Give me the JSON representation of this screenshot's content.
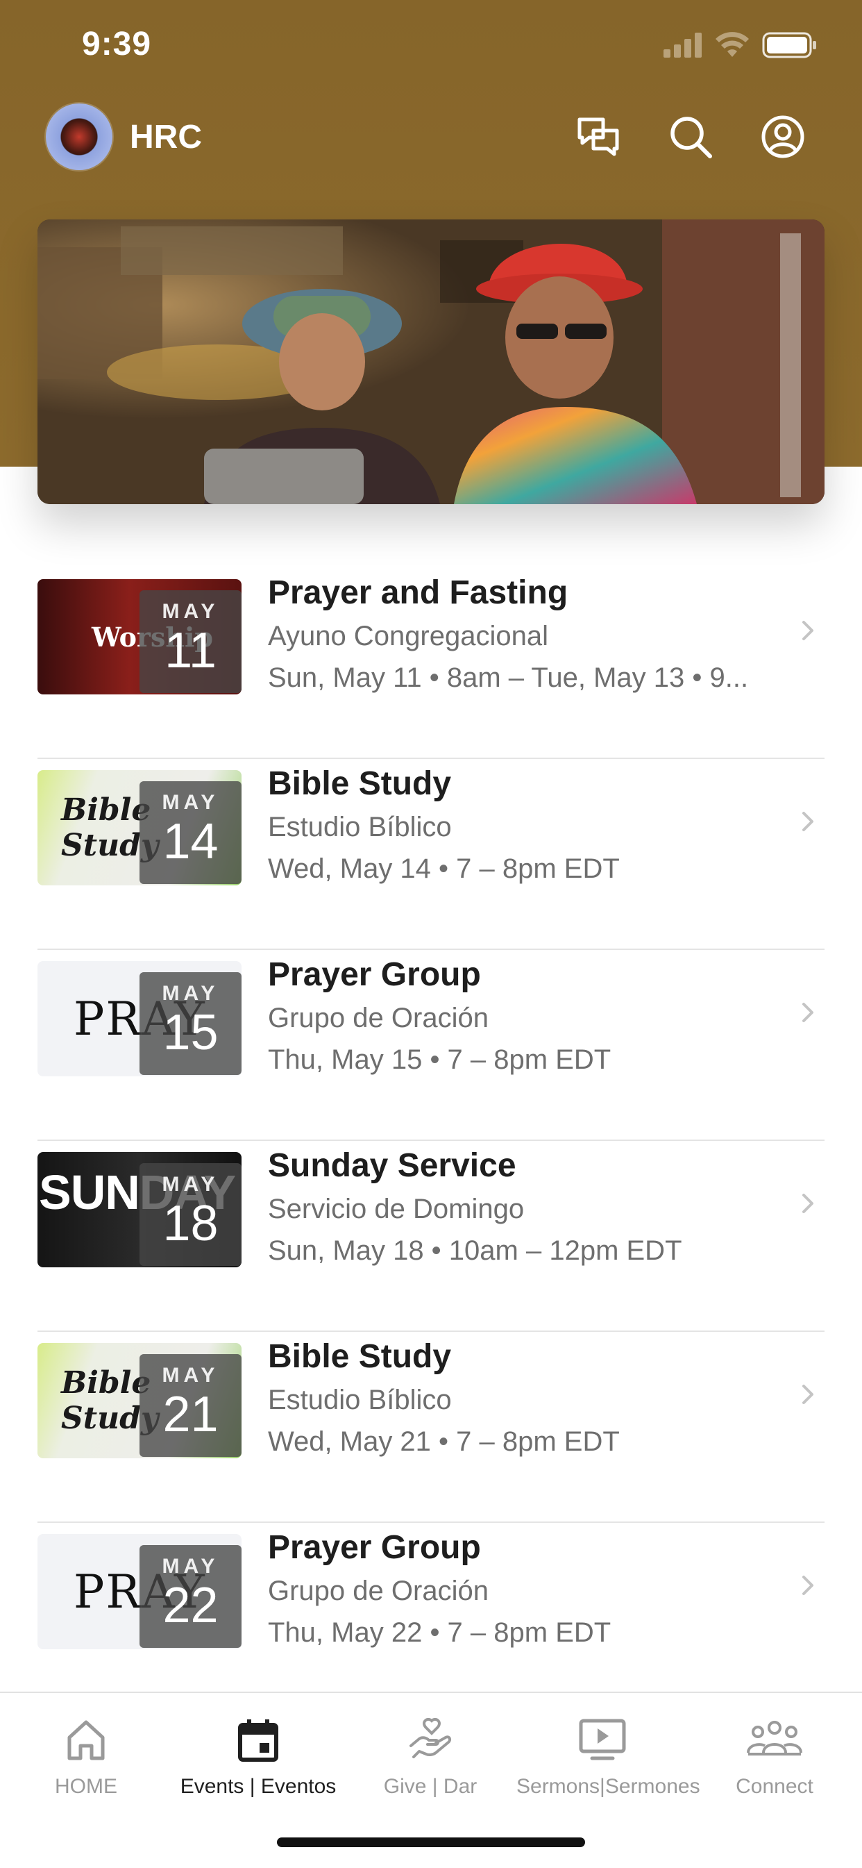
{
  "status_bar": {
    "time": "9:39"
  },
  "app_bar": {
    "org_name": "HRC",
    "icons": [
      "chat-icon",
      "search-icon",
      "account-icon"
    ]
  },
  "hero": {
    "image": "two men in bucket hats smiling on stage"
  },
  "events": [
    {
      "title": "Prayer and Fasting",
      "subtitle": "Ayuno Congregacional",
      "time": "Sun, May 11 • 8am – Tue, May 13 • 9...",
      "month": "MAY",
      "day": "11",
      "thumb_text": "Worship"
    },
    {
      "title": "Bible Study",
      "subtitle": "Estudio Bíblico",
      "time": "Wed, May 14 • 7 – 8pm EDT",
      "month": "MAY",
      "day": "14",
      "thumb_text": "Bible Study"
    },
    {
      "title": "Prayer Group",
      "subtitle": "Grupo de Oración",
      "time": "Thu, May 15 • 7 – 8pm EDT",
      "month": "MAY",
      "day": "15",
      "thumb_text": "PRAY"
    },
    {
      "title": "Sunday Service",
      "subtitle": "Servicio de Domingo",
      "time": "Sun, May 18 • 10am – 12pm EDT",
      "month": "MAY",
      "day": "18",
      "thumb_text": "SUNDAY"
    },
    {
      "title": "Bible Study",
      "subtitle": "Estudio Bíblico",
      "time": "Wed, May 21 • 7 – 8pm EDT",
      "month": "MAY",
      "day": "21",
      "thumb_text": "Bible Study"
    },
    {
      "title": "Prayer Group",
      "subtitle": "Grupo de Oración",
      "time": "Thu, May 22 • 7 – 8pm EDT",
      "month": "MAY",
      "day": "22",
      "thumb_text": "PRAY"
    }
  ],
  "tabs": [
    {
      "label": "HOME",
      "icon": "home-icon",
      "active": false
    },
    {
      "label": "Events | Eventos",
      "icon": "calendar-icon",
      "active": true
    },
    {
      "label": "Give | Dar",
      "icon": "give-hand-heart-icon",
      "active": false
    },
    {
      "label": "Sermons|Sermones",
      "icon": "tv-play-icon",
      "active": false
    },
    {
      "label": "Connect",
      "icon": "group-icon",
      "active": false
    }
  ],
  "colors": {
    "header_bg": "#8a6a2c",
    "active_tab": "#1f1f1f",
    "inactive_tab": "#9a9a9a"
  }
}
